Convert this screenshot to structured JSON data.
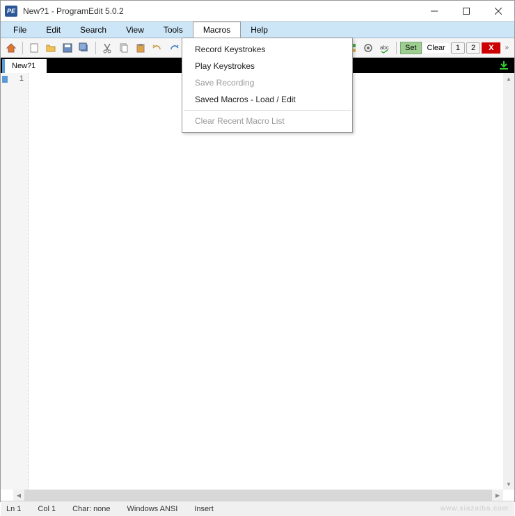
{
  "titlebar": {
    "app_icon_text": "PE",
    "title": "New?1  -  ProgramEdit 5.0.2"
  },
  "menubar": {
    "items": [
      "File",
      "Edit",
      "Search",
      "View",
      "Tools",
      "Macros",
      "Help"
    ],
    "active_index": 5
  },
  "toolbar": {
    "set_label": "Set",
    "clear_label": "Clear",
    "num1": "1",
    "num2": "2",
    "x_label": "X"
  },
  "tabbar": {
    "tab_label": "New?1"
  },
  "editor": {
    "line_number": "1"
  },
  "dropdown": {
    "items": [
      {
        "label": "Record Keystrokes",
        "disabled": false
      },
      {
        "label": "Play Keystrokes",
        "disabled": false
      },
      {
        "label": "Save Recording",
        "disabled": true
      },
      {
        "label": "Saved Macros - Load / Edit",
        "disabled": false
      }
    ],
    "sep_after_index": 3,
    "footer_item": {
      "label": "Clear Recent Macro List",
      "disabled": true
    }
  },
  "statusbar": {
    "ln": "Ln 1",
    "col": "Col 1",
    "char": "Char: none",
    "encoding": "Windows  ANSI",
    "mode": "Insert",
    "watermark": "www.xiazaiba.com"
  }
}
